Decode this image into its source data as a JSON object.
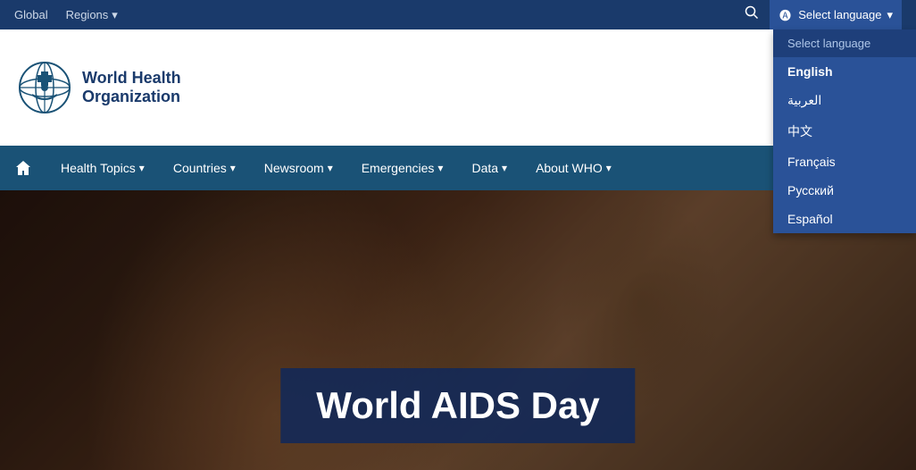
{
  "topbar": {
    "global_label": "Global",
    "regions_label": "Regions",
    "select_language_label": "Select language"
  },
  "language_dropdown": {
    "header": "Select language",
    "options": [
      {
        "code": "en",
        "label": "English",
        "active": true
      },
      {
        "code": "ar",
        "label": "العربية",
        "active": false
      },
      {
        "code": "zh",
        "label": "中文",
        "active": false
      },
      {
        "code": "fr",
        "label": "Français",
        "active": false
      },
      {
        "code": "ru",
        "label": "Русский",
        "active": false
      },
      {
        "code": "es",
        "label": "Español",
        "active": false
      }
    ]
  },
  "logo": {
    "org_line1": "World Health",
    "org_line2": "Organization"
  },
  "nav": {
    "home_label": "🏠",
    "items": [
      {
        "label": "Health Topics",
        "has_dropdown": true
      },
      {
        "label": "Countries",
        "has_dropdown": true
      },
      {
        "label": "Newsroom",
        "has_dropdown": true
      },
      {
        "label": "Emergencies",
        "has_dropdown": true
      },
      {
        "label": "Data",
        "has_dropdown": true
      },
      {
        "label": "About WHO",
        "has_dropdown": true
      }
    ]
  },
  "hero": {
    "title": "World AIDS Day"
  }
}
